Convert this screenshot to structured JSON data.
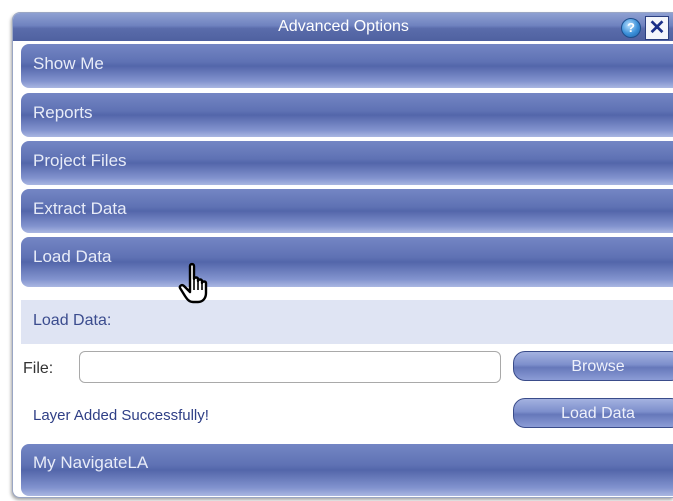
{
  "dialog": {
    "title": "Advanced Options",
    "help_glyph": "?",
    "close_glyph": "✕"
  },
  "sections": [
    {
      "label": "Show Me"
    },
    {
      "label": "Reports"
    },
    {
      "label": "Project Files"
    },
    {
      "label": "Extract Data"
    },
    {
      "label": "Load Data"
    },
    {
      "label": "My NavigateLA"
    }
  ],
  "load_data": {
    "heading": "Load Data:",
    "file_label": "File:",
    "file_value": "",
    "browse_label": "Browse",
    "status": "Layer Added Successfully!",
    "load_button_label": "Load Data"
  },
  "colors": {
    "header_blue": "#5366aa",
    "panel_bg": "#dfe4f3",
    "status_text": "#2f3f86"
  },
  "icons": [
    "help-icon",
    "close-icon",
    "hand-pointer-cursor"
  ]
}
